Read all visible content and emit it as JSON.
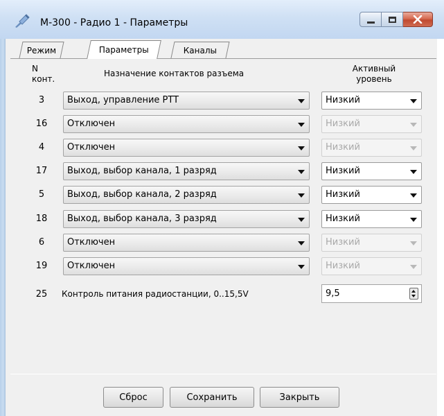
{
  "window": {
    "title": "M-300 - Радио 1 - Параметры"
  },
  "tabs": [
    {
      "label": "Режим",
      "active": false
    },
    {
      "label": "Параметры",
      "active": true
    },
    {
      "label": "Каналы",
      "active": false
    }
  ],
  "table": {
    "col_num_header": "N\nконт.",
    "col_assign_header": "Назначение контактов разъема",
    "col_level_header": "Активный\nуровень",
    "rows": [
      {
        "num": "3",
        "assign": "Выход, управление PTT",
        "level": "Низкий",
        "level_enabled": true
      },
      {
        "num": "16",
        "assign": "Отключен",
        "level": "Низкий",
        "level_enabled": false
      },
      {
        "num": "4",
        "assign": "Отключен",
        "level": "Низкий",
        "level_enabled": false
      },
      {
        "num": "17",
        "assign": "Выход, выбор канала, 1 разряд",
        "level": "Низкий",
        "level_enabled": true
      },
      {
        "num": "5",
        "assign": "Выход, выбор канала, 2 разряд",
        "level": "Низкий",
        "level_enabled": true
      },
      {
        "num": "18",
        "assign": "Выход, выбор канала, 3 разряд",
        "level": "Низкий",
        "level_enabled": true
      },
      {
        "num": "6",
        "assign": "Отключен",
        "level": "Низкий",
        "level_enabled": false
      },
      {
        "num": "19",
        "assign": "Отключен",
        "level": "Низкий",
        "level_enabled": false
      }
    ]
  },
  "power": {
    "num": "25",
    "label": "Контроль питания радиостанции, 0..15,5V",
    "value": "9,5"
  },
  "buttons": {
    "reset": "Сброс",
    "save": "Сохранить",
    "close": "Закрыть"
  }
}
